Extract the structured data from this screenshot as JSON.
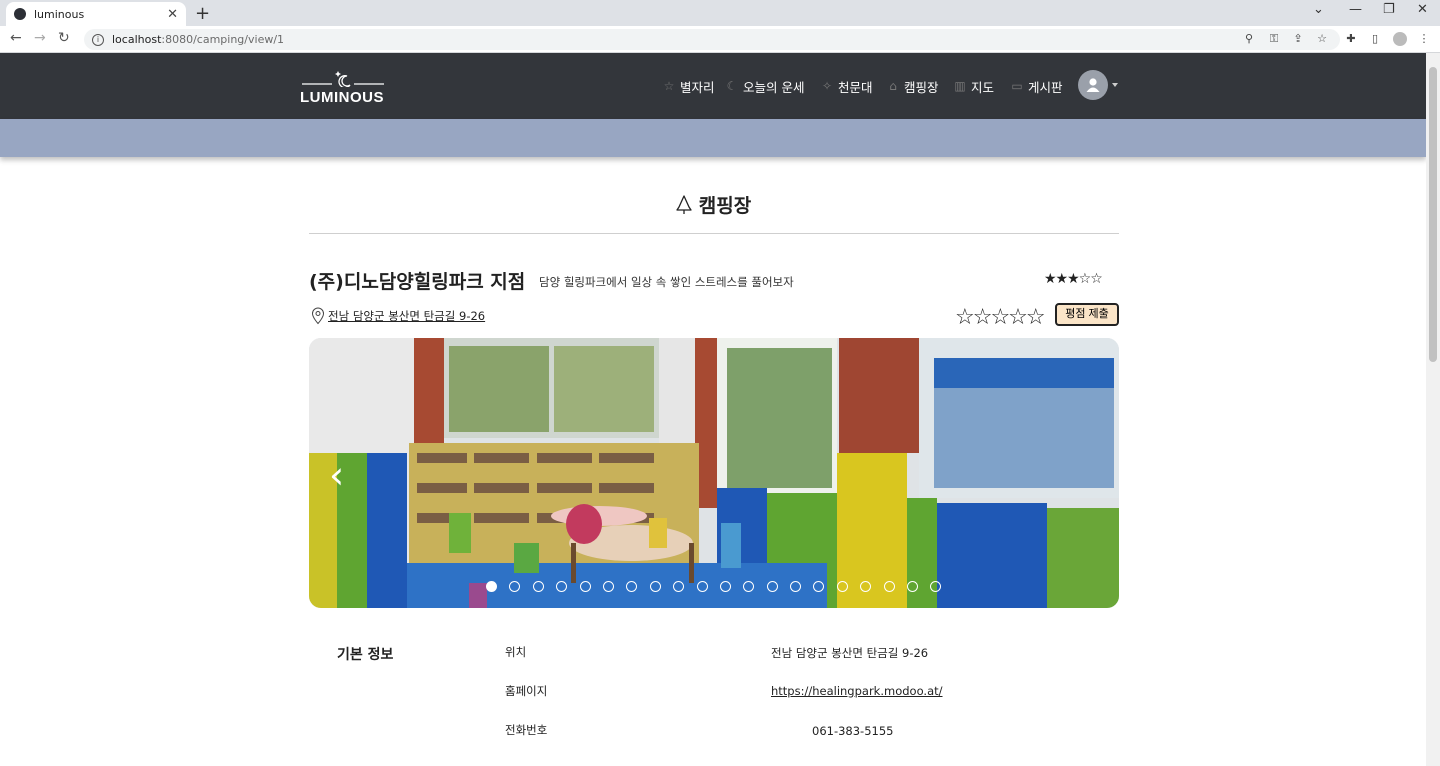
{
  "browser": {
    "tab_title": "luminous",
    "url_host": "localhost",
    "url_path": ":8080/camping/view/1",
    "new_tab": "+",
    "tab_close": "✕"
  },
  "header": {
    "logo_text": "LUMINOUS",
    "menu": [
      {
        "label": "별자리",
        "icon": "star-icon"
      },
      {
        "label": "오늘의 운세",
        "icon": "moon-icon"
      },
      {
        "label": "천문대",
        "icon": "sparkle-icon"
      },
      {
        "label": "캠핑장",
        "icon": "tree-icon"
      },
      {
        "label": "지도",
        "icon": "map-icon"
      },
      {
        "label": "게시판",
        "icon": "clipboard-icon"
      }
    ]
  },
  "page": {
    "section_title": "캠핑장",
    "camp_name": "(주)디노담양힐링파크 지점",
    "camp_subtitle": "담양 힐링파크에서 일상 속 쌓인 스트레스를 풀어보자",
    "average_rating": 3.5,
    "average_stars_text": "★★★☆☆",
    "address": "전남 담양군 봉산면 탄금길 9-26",
    "rating_input_stars": "☆☆☆☆☆",
    "rating_submit_label": "평점 제출",
    "carousel": {
      "prev_label": "‹",
      "slide_count": 20,
      "active_index": 0
    }
  },
  "info": {
    "heading": "기본 정보",
    "rows": [
      {
        "label": "위치",
        "value": "전남 담양군 봉산면 탄금길 9-26"
      },
      {
        "label": "홈페이지",
        "value": "https://healingpark.modoo.at/"
      },
      {
        "label": "전화번호",
        "value": "061-383-5155"
      }
    ]
  },
  "colors": {
    "header_bg": "#33363b",
    "banner_bg": "#98a6c2",
    "rate_button_bg": "#fbe5c8"
  }
}
